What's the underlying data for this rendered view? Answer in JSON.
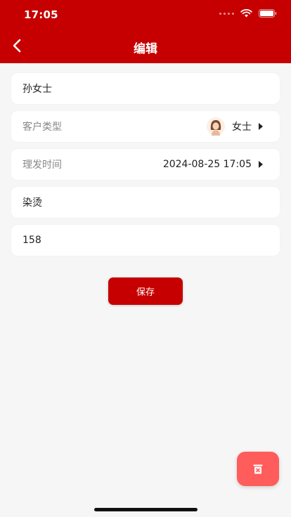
{
  "status_bar": {
    "time": "17:05"
  },
  "header": {
    "title": "编辑"
  },
  "form": {
    "name": {
      "value": "孙女士"
    },
    "customer_type": {
      "label": "客户类型",
      "value": "女士",
      "avatar_icon": "woman-avatar-icon"
    },
    "haircut_time": {
      "label": "理发时间",
      "value": "2024-08-25 17:05"
    },
    "service": {
      "value": "染烫"
    },
    "amount": {
      "value": "158"
    }
  },
  "actions": {
    "save_label": "保存",
    "delete_icon": "trash-icon"
  },
  "colors": {
    "primary": "#c60000",
    "delete_fab": "#ff5c5c",
    "background": "#f6f6f6"
  }
}
